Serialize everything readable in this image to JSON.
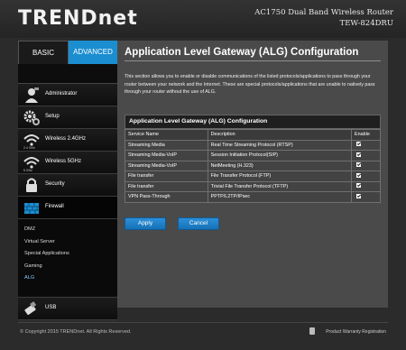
{
  "header": {
    "logo": "TRENDnet",
    "product_line": "AC1750 Dual Band Wireless Router",
    "model": "TEW-824DRU"
  },
  "sidebar": {
    "tabs": [
      {
        "label": "BASIC"
      },
      {
        "label": "ADVANCED"
      }
    ],
    "items": [
      {
        "label": "Administrator",
        "icon": "admin-person-icon"
      },
      {
        "label": "Setup",
        "icon": "gear-icon"
      },
      {
        "label": "Wireless 2.4GHz",
        "sub": "2.4 GHz",
        "icon": "wifi-icon"
      },
      {
        "label": "Wireless 5GHz",
        "sub": "5 GHz",
        "icon": "wifi-icon"
      },
      {
        "label": "Security",
        "icon": "lock-icon"
      },
      {
        "label": "Firewall",
        "icon": "firewall-icon"
      },
      {
        "label": "USB",
        "icon": "usb-icon"
      }
    ],
    "firewall_sub": [
      "DMZ",
      "Virtual Server",
      "Special Applications",
      "Gaming",
      "ALG"
    ],
    "active_sub": "ALG"
  },
  "main": {
    "title": "Application Level Gateway (ALG) Configuration",
    "description": "This section allows you to enable or disable communications of the listed protocols/applications to pass through your router between your network and the Internet. These are special protocols/applications that are unable to natively pass through your router without the use of ALG.",
    "panel_title": "Application Level Gateway (ALG) Configuration",
    "columns": [
      "Service Name",
      "Description",
      "Enable"
    ],
    "rows": [
      {
        "name": "Streaming Media",
        "desc": "Real Time Streaming Protocol (RTSP)",
        "enabled": true
      },
      {
        "name": "Streaming Media-VoIP",
        "desc": "Session Initiation Protocol(SIP)",
        "enabled": true
      },
      {
        "name": "Streaming Media-VoIP",
        "desc": "NetMeeting (H.323)",
        "enabled": true
      },
      {
        "name": "File transfer",
        "desc": "File Transfer Protocol (FTP)",
        "enabled": true
      },
      {
        "name": "File transfer",
        "desc": "Trivial File Transfer Protocol (TFTP)",
        "enabled": true
      },
      {
        "name": "VPN Pass-Through",
        "desc": "PPTP/L2TP/IPsec",
        "enabled": true
      }
    ],
    "apply_label": "Apply",
    "cancel_label": "Cancel"
  },
  "footer": {
    "copyright": "© Copyright 2015 TRENDnet. All Rights Reserved.",
    "warranty": "Product Warranty Registration"
  },
  "colors": {
    "accent": "#1b8ed0",
    "background": "#2b2b2b",
    "content": "#4a4a4a"
  }
}
